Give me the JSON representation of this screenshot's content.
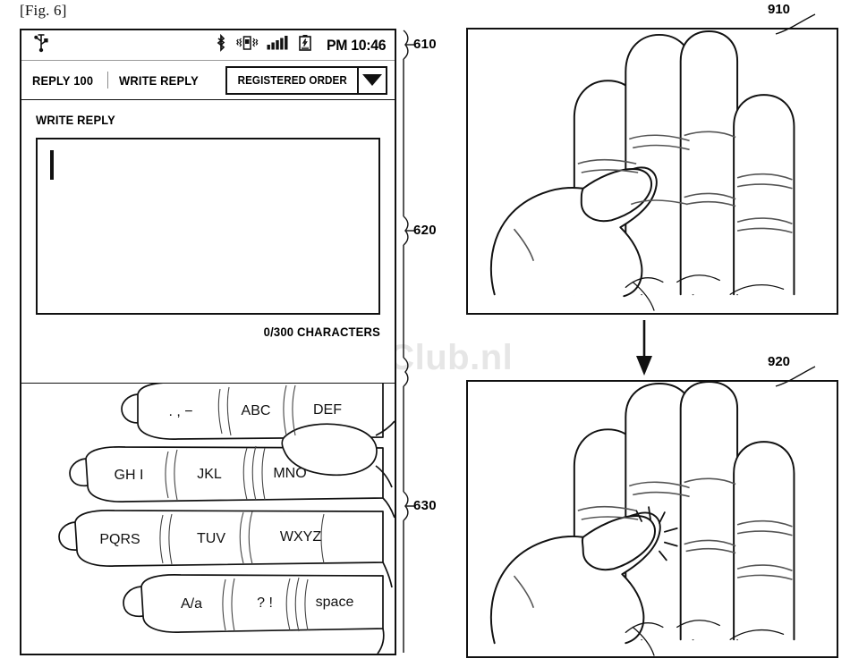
{
  "figure": {
    "caption": "[Fig. 6]",
    "watermark": "GalaxyClub.nl"
  },
  "phone": {
    "status_bar": {
      "icons": [
        "usb-icon",
        "bluetooth-icon",
        "vibrate-icon",
        "signal-bars-icon",
        "battery-icon"
      ],
      "time": "PM 10:46"
    },
    "tab_bar": {
      "tab_reply": "REPLY 100",
      "separator": "|",
      "tab_write_reply": "WRITE REPLY",
      "sort_dropdown": {
        "value": "REGISTERED ORDER",
        "icon": "chevron-down-icon"
      }
    },
    "compose": {
      "title": "WRITE REPLY",
      "input_value": "",
      "caret": "|",
      "char_count": "0/300 CHARACTERS"
    },
    "keyboard": {
      "rows": [
        {
          "keys": [
            ". , −",
            "ABC",
            "DEF"
          ]
        },
        {
          "keys": [
            "GH I",
            "JKL",
            "MNO"
          ]
        },
        {
          "keys": [
            "PQRS",
            "TUV",
            "WXYZ"
          ]
        },
        {
          "keys": [
            "A/a",
            "? !",
            "space"
          ]
        }
      ]
    }
  },
  "reference_numbers": {
    "status_and_tabs": "610",
    "compose_area": "620",
    "keyboard_area": "630",
    "hand_before": "910",
    "hand_after": "920"
  },
  "panels": [
    {
      "id": "910",
      "label": "910",
      "description": "hand-open-thumb-near-index-finger"
    },
    {
      "id": "920",
      "label": "920",
      "description": "hand-thumb-tapping-middle-finger-with-impact-marks"
    }
  ],
  "flow_arrow": "down-arrow-icon"
}
